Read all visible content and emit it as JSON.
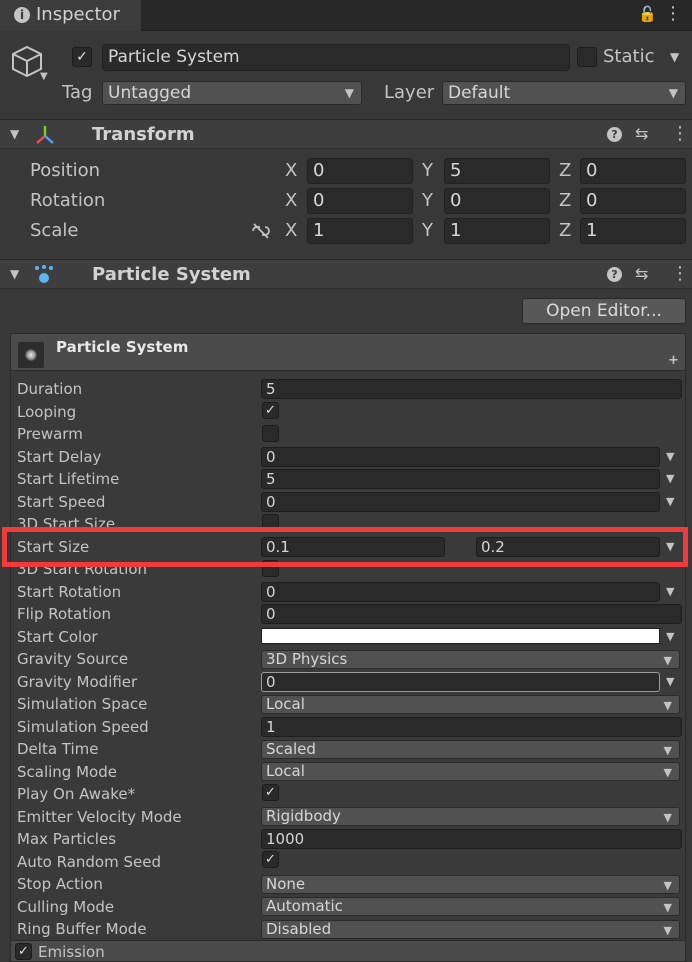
{
  "tab": {
    "title": "Inspector",
    "info_glyph": "i",
    "lock_glyph": "🔓",
    "menu_glyph": "⋮"
  },
  "header": {
    "active_check": "✓",
    "name": "Particle System",
    "static_label": "Static",
    "tag_label": "Tag",
    "tag_value": "Untagged",
    "layer_label": "Layer",
    "layer_value": "Default"
  },
  "transform": {
    "title": "Transform",
    "position": {
      "label": "Position",
      "x": "0",
      "y": "5",
      "z": "0"
    },
    "rotation": {
      "label": "Rotation",
      "x": "0",
      "y": "0",
      "z": "0"
    },
    "scale": {
      "label": "Scale",
      "x": "1",
      "y": "1",
      "z": "1"
    },
    "axis_x": "X",
    "axis_y": "Y",
    "axis_z": "Z"
  },
  "particle_component": {
    "title": "Particle System",
    "open_editor": "Open Editor...",
    "module_title": "Particle System",
    "rows": {
      "duration": {
        "label": "Duration",
        "value": "5"
      },
      "looping": {
        "label": "Looping",
        "check": "✓"
      },
      "prewarm": {
        "label": "Prewarm"
      },
      "start_delay": {
        "label": "Start Delay",
        "value": "0"
      },
      "start_lifetime": {
        "label": "Start Lifetime",
        "value": "5"
      },
      "start_speed": {
        "label": "Start Speed",
        "value": "0"
      },
      "start_size_3d": {
        "label": "3D Start Size"
      },
      "start_size": {
        "label": "Start Size",
        "min": "0.1",
        "max": "0.2"
      },
      "start_rotation_3d": {
        "label": "3D Start Rotation"
      },
      "start_rotation": {
        "label": "Start Rotation",
        "value": "0"
      },
      "flip_rotation": {
        "label": "Flip Rotation",
        "value": "0"
      },
      "start_color": {
        "label": "Start Color",
        "color": "#ffffff"
      },
      "gravity_source": {
        "label": "Gravity Source",
        "value": "3D Physics"
      },
      "gravity_modifier": {
        "label": "Gravity Modifier",
        "value": "0"
      },
      "simulation_space": {
        "label": "Simulation Space",
        "value": "Local"
      },
      "simulation_speed": {
        "label": "Simulation Speed",
        "value": "1"
      },
      "delta_time": {
        "label": "Delta Time",
        "value": "Scaled"
      },
      "scaling_mode": {
        "label": "Scaling Mode",
        "value": "Local"
      },
      "play_on_awake": {
        "label": "Play On Awake*",
        "check": "✓"
      },
      "emitter_velocity_mode": {
        "label": "Emitter Velocity Mode",
        "value": "Rigidbody"
      },
      "max_particles": {
        "label": "Max Particles",
        "value": "1000"
      },
      "auto_random_seed": {
        "label": "Auto Random Seed",
        "check": "✓"
      },
      "stop_action": {
        "label": "Stop Action",
        "value": "None"
      },
      "culling_mode": {
        "label": "Culling Mode",
        "value": "Automatic"
      },
      "ring_buffer_mode": {
        "label": "Ring Buffer Mode",
        "value": "Disabled"
      }
    },
    "emission": {
      "label": "Emission",
      "check": "✓"
    }
  },
  "colors": {
    "highlight": "#ef3b3b",
    "background": "#383838"
  }
}
